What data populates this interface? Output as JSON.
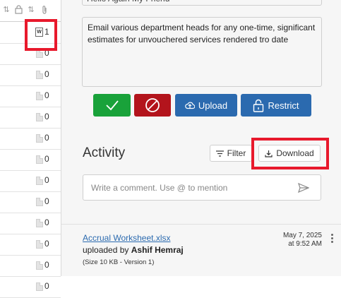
{
  "attachments_column": {
    "rows": [
      {
        "count": "1",
        "icon": "word-doc-icon"
      },
      {
        "count": "0",
        "icon": "document-icon"
      },
      {
        "count": "0",
        "icon": "document-icon"
      },
      {
        "count": "0",
        "icon": "document-icon"
      },
      {
        "count": "0",
        "icon": "document-icon"
      },
      {
        "count": "0",
        "icon": "document-icon"
      },
      {
        "count": "0",
        "icon": "document-icon"
      },
      {
        "count": "0",
        "icon": "document-icon"
      },
      {
        "count": "0",
        "icon": "document-icon"
      },
      {
        "count": "0",
        "icon": "document-icon"
      },
      {
        "count": "0",
        "icon": "document-icon"
      },
      {
        "count": "0",
        "icon": "document-icon"
      },
      {
        "count": "0",
        "icon": "document-icon"
      }
    ]
  },
  "previous_comment": "Hello Again My Friend",
  "comment_text": "Email various department heads for any one-time, significant estimates for unvouchered services rendered tro date",
  "actions": {
    "upload_label": "Upload",
    "restrict_label": "Restrict"
  },
  "activity": {
    "title": "Activity",
    "filter_label": "Filter",
    "download_label": "Download",
    "compose_placeholder": "Write a comment. Use @ to mention"
  },
  "entry": {
    "file_name": "Accrual Worksheet.xlsx",
    "uploaded_prefix": "uploaded by",
    "uploader": "Ashif Hemraj",
    "size_info": "(Size 10 KB - Version 1)",
    "date": "May 7, 2025",
    "time": "at 9:52 AM"
  },
  "colors": {
    "approve": "#19a23a",
    "reject": "#b3141c",
    "primary": "#2b6aaf",
    "highlight": "#e8192c"
  }
}
